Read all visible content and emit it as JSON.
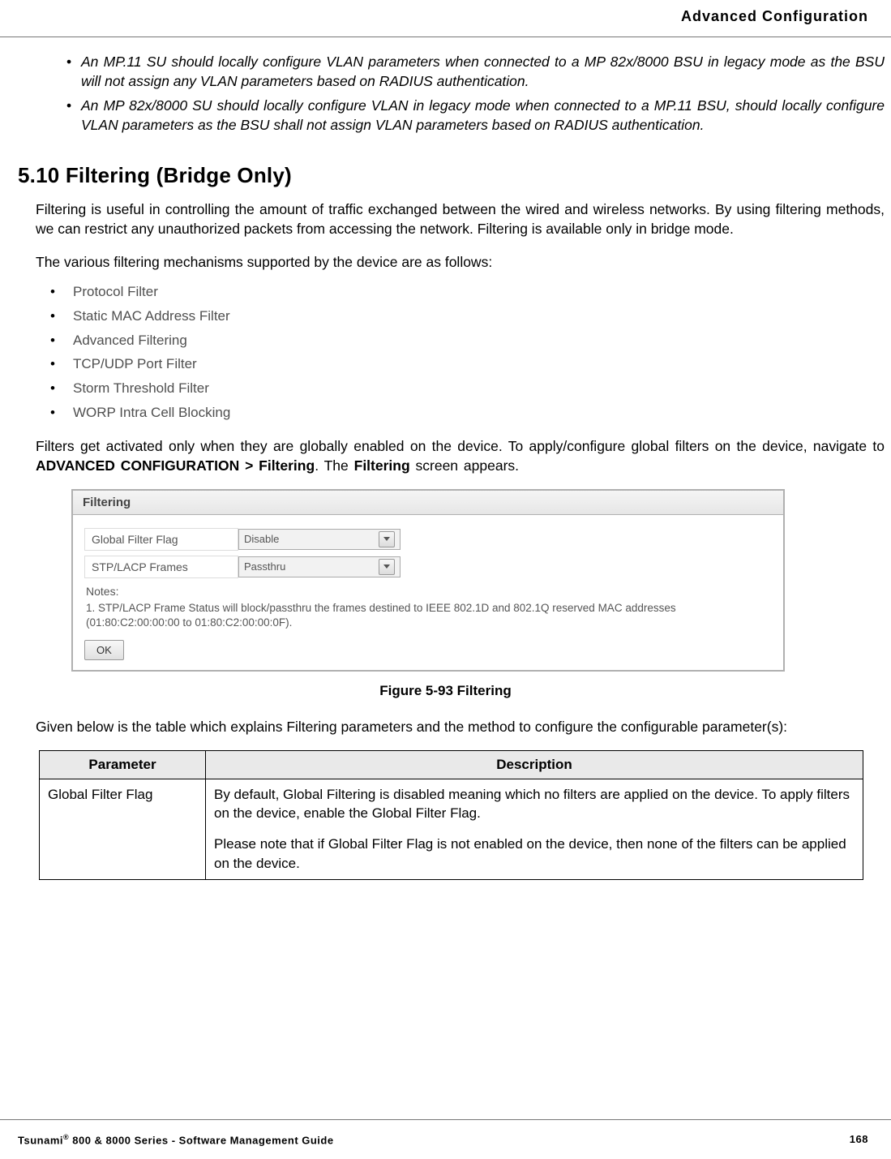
{
  "header": {
    "title": "Advanced Configuration"
  },
  "intro_notes": [
    "An MP.11 SU should locally configure VLAN parameters when connected to a MP 82x/8000 BSU in legacy mode as the BSU will not assign any VLAN parameters based on RADIUS authentication.",
    "An MP 82x/8000 SU should locally configure VLAN in legacy mode when connected to a MP.11 BSU, should locally configure VLAN parameters as the BSU shall not assign VLAN parameters based on RADIUS authentication."
  ],
  "section": {
    "heading": "5.10 Filtering (Bridge Only)",
    "p1": "Filtering is useful in controlling the amount of traffic exchanged between the wired and wireless networks. By using filtering methods, we can restrict any unauthorized packets from accessing the network. Filtering is available only in bridge mode.",
    "p2": "The various filtering mechanisms supported by the device are as follows:",
    "mechanisms": [
      "Protocol Filter",
      "Static MAC Address Filter",
      "Advanced Filtering",
      "TCP/UDP Port Filter",
      "Storm Threshold Filter",
      "WORP Intra Cell Blocking"
    ],
    "p3_pre": "Filters get activated only when they are globally enabled on the device. To apply/configure global filters on the device, navigate to ",
    "p3_bold1": "ADVANCED CONFIGURATION > Filtering",
    "p3_mid": ". The ",
    "p3_bold2": "Filtering",
    "p3_post": " screen appears."
  },
  "figure": {
    "panel_title": "Filtering",
    "row1_label": "Global Filter Flag",
    "row1_value": "Disable",
    "row2_label": "STP/LACP Frames",
    "row2_value": "Passthru",
    "notes_label": "Notes:",
    "note1": "1. STP/LACP Frame Status will block/passthru the frames destined to IEEE 802.1D and 802.1Q reserved MAC addresses (01:80:C2:00:00:00 to 01:80:C2:00:00:0F).",
    "ok_label": "OK",
    "caption": "Figure 5-93 Filtering"
  },
  "table_intro": "Given below is the table which explains Filtering parameters and the method to configure the configurable parameter(s):",
  "table": {
    "th1": "Parameter",
    "th2": "Description",
    "r1c1": "Global Filter Flag",
    "r1c2a": "By default, Global Filtering is disabled meaning which no filters are applied on the device. To apply filters on the device, enable the Global Filter Flag.",
    "r1c2b": "Please note that if Global Filter Flag is not enabled on the device, then none of the filters can be applied on the device."
  },
  "footer": {
    "left_pre": "Tsunami",
    "left_reg": "®",
    "left_post": " 800 & 8000 Series - Software Management Guide",
    "page": "168"
  }
}
